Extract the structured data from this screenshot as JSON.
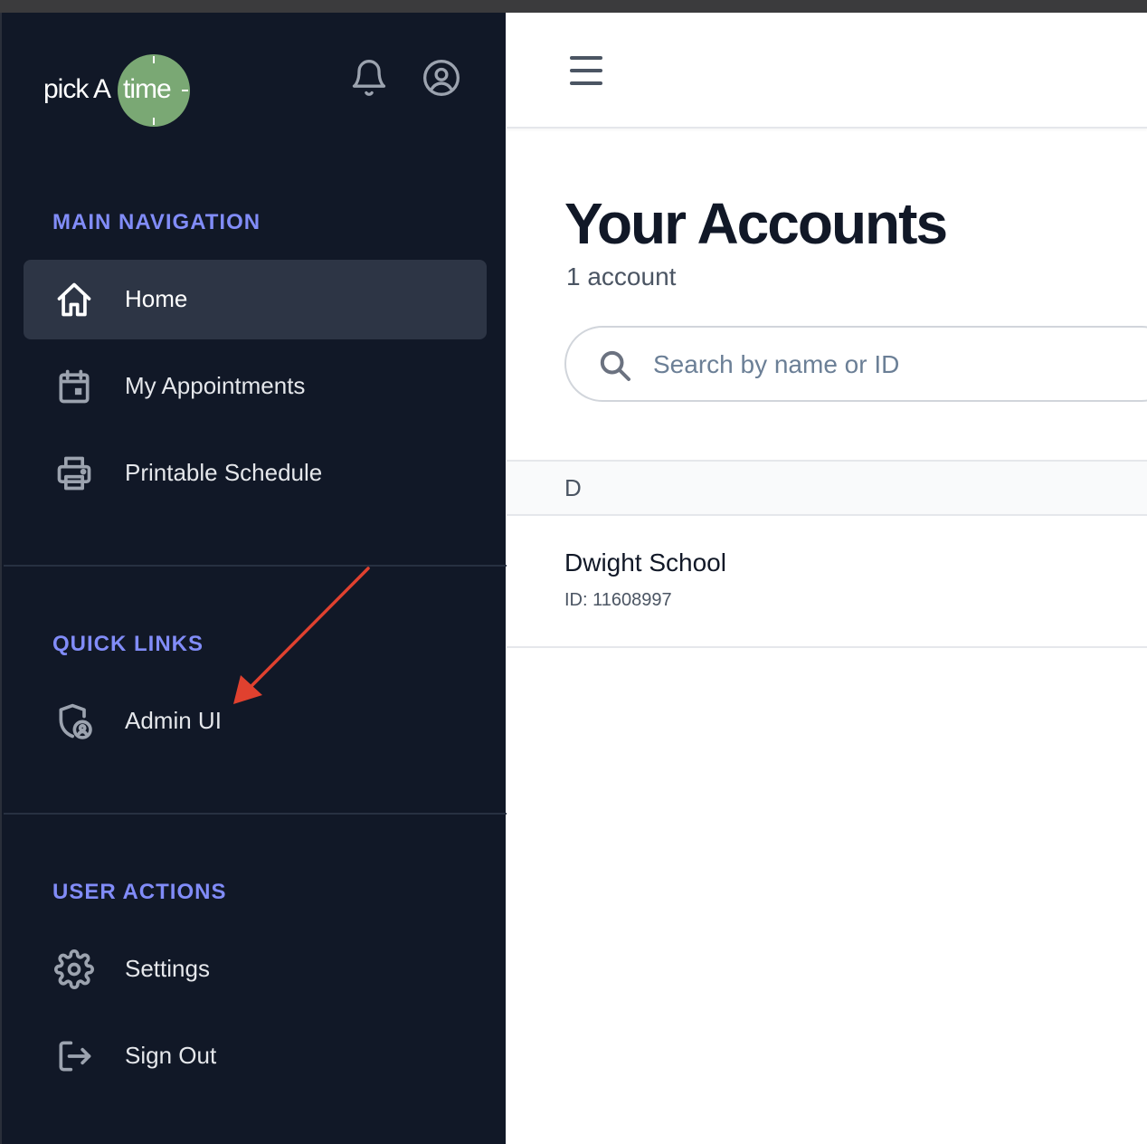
{
  "app": {
    "logo_pick": "pick A",
    "logo_time": "time"
  },
  "sidebar": {
    "sections": [
      {
        "title": "MAIN NAVIGATION",
        "items": [
          {
            "label": "Home",
            "icon": "home-icon",
            "active": true
          },
          {
            "label": "My Appointments",
            "icon": "calendar-icon",
            "active": false
          },
          {
            "label": "Printable Schedule",
            "icon": "printer-icon",
            "active": false
          }
        ]
      },
      {
        "title": "QUICK LINKS",
        "items": [
          {
            "label": "Admin UI",
            "icon": "admin-shield-icon",
            "active": false
          }
        ]
      },
      {
        "title": "USER ACTIONS",
        "items": [
          {
            "label": "Settings",
            "icon": "gear-icon",
            "active": false
          },
          {
            "label": "Sign Out",
            "icon": "sign-out-icon",
            "active": false
          }
        ]
      }
    ]
  },
  "header_icons": [
    "bell-icon",
    "user-circle-icon",
    "hamburger-menu-icon"
  ],
  "main": {
    "title": "Your Accounts",
    "subtitle": "1 account",
    "search": {
      "placeholder": "Search by name or ID",
      "value": ""
    },
    "groups": [
      {
        "letter": "D",
        "accounts": [
          {
            "name": "Dwight School",
            "id_text": "ID: 11608997"
          }
        ]
      }
    ]
  },
  "colors": {
    "sidebar_bg": "#111827",
    "active_item_bg": "#2d3545",
    "section_title": "#818cf8",
    "logo_clock": "#7aa874",
    "annotation_arrow": "#e0412f"
  }
}
